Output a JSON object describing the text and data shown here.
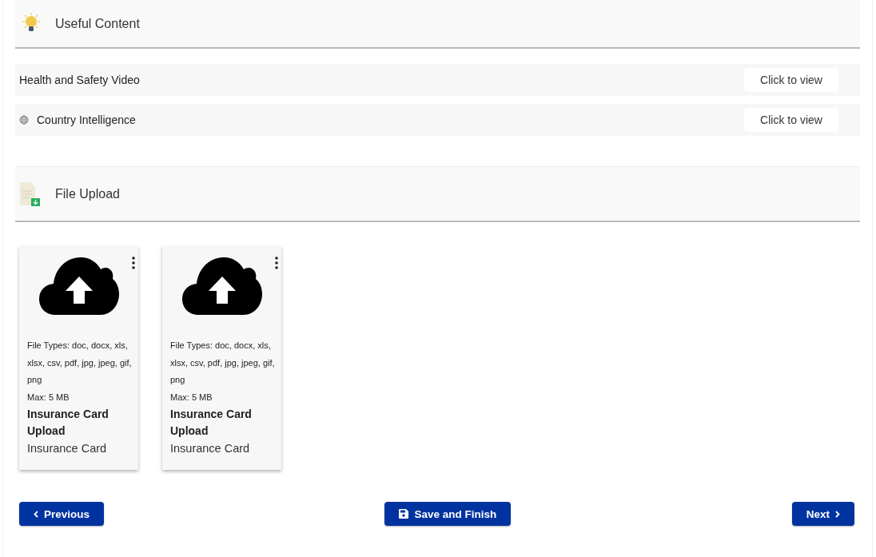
{
  "useful_content": {
    "title": "Useful Content",
    "items": [
      {
        "kind": "plain",
        "label": "Health and Safety Video",
        "action": "Click to view"
      },
      {
        "kind": "globe",
        "label": "Country Intelligence",
        "action": "Click to view"
      }
    ]
  },
  "file_upload": {
    "title": "File Upload",
    "cards": [
      {
        "file_types": "File Types: doc, docx, xls, xlsx, csv, pdf, jpg, jpeg, gif, png",
        "max": "Max: 5 MB",
        "title": "Insurance Card Upload",
        "subtitle": "Insurance Card"
      },
      {
        "file_types": "File Types: doc, docx, xls, xlsx, csv, pdf, jpg, jpeg, gif, png",
        "max": "Max: 5 MB",
        "title": "Insurance Card Upload",
        "subtitle": "Insurance Card"
      }
    ]
  },
  "buttons": [
    {
      "kind": "previous",
      "label": "Previous"
    },
    {
      "kind": "save",
      "label": "Save and Finish"
    },
    {
      "kind": "next",
      "label": "Next"
    }
  ]
}
